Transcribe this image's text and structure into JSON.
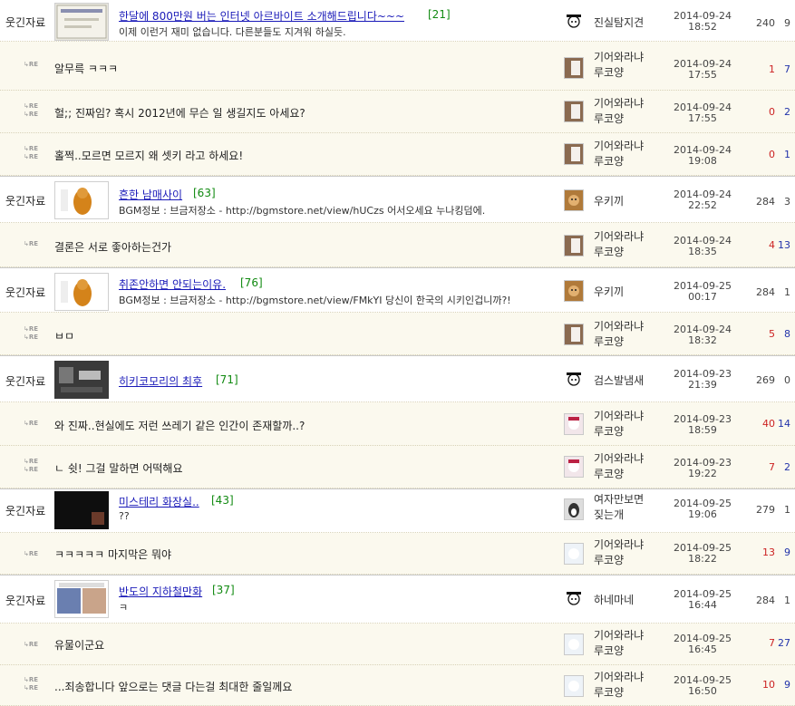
{
  "rows": [
    {
      "type": "post",
      "category": "웃긴자료",
      "title": "한달에 800만원 버는 인터넷 아르바이트 소개해드립니다~~~",
      "count": "[21]",
      "desc": "이제 이런거 재미 없습니다. 다른분들도 지겨워 하실듯.",
      "author": "진실탐지견",
      "date": "2014-09-24",
      "time": "18:52",
      "n1": "240",
      "n2": "9"
    },
    {
      "type": "reply",
      "text": "알무륵 ㅋㅋㅋ",
      "author1": "기어와라냐",
      "author2": "루코양",
      "date": "2014-09-24",
      "time": "17:55",
      "n1": "1",
      "n2": "7"
    },
    {
      "type": "reply",
      "text": "헐;; 진짜임? 혹시 2012년에 무슨 일 생길지도 아세요?",
      "author1": "기어와라냐",
      "author2": "루코양",
      "date": "2014-09-24",
      "time": "17:55",
      "n1": "0",
      "n2": "2"
    },
    {
      "type": "reply",
      "text": "홀쩍..모르면 모르지 왜 셋키 라고 하세요!",
      "author1": "기어와라냐",
      "author2": "루코양",
      "date": "2014-09-24",
      "time": "19:08",
      "n1": "0",
      "n2": "1"
    },
    {
      "type": "post",
      "category": "웃긴자료",
      "title": "흔한 남매사이",
      "count": "[63]",
      "desc": "BGM정보 : 브금저장소 - http://bgmstore.net/view/hUCzs 어서오세요 누나킹덤에.",
      "author": "우키끼",
      "date": "2014-09-24",
      "time": "22:52",
      "n1": "284",
      "n2": "3"
    },
    {
      "type": "reply",
      "text": "결론은 서로 좋아하는건가",
      "author1": "기어와라냐",
      "author2": "루코양",
      "date": "2014-09-24",
      "time": "18:35",
      "n1": "4",
      "n2": "13"
    },
    {
      "type": "post",
      "category": "웃긴자료",
      "title": "취존안하면 안되는이유.",
      "count": "[76]",
      "desc": "BGM정보 : 브금저장소 - http://bgmstore.net/view/FMkYI 당신이 한국의 시키인겁니까?!",
      "author": "우키끼",
      "date": "2014-09-25",
      "time": "00:17",
      "n1": "284",
      "n2": "1"
    },
    {
      "type": "reply",
      "text": "ㅂㅁ",
      "author1": "기어와라냐",
      "author2": "루코양",
      "date": "2014-09-24",
      "time": "18:32",
      "n1": "5",
      "n2": "8"
    },
    {
      "type": "post",
      "category": "웃긴자료",
      "title": "히키코모리의 최후",
      "count": "[71]",
      "desc": "",
      "author": "검스발냄새",
      "date": "2014-09-23",
      "time": "21:39",
      "n1": "269",
      "n2": "0"
    },
    {
      "type": "reply",
      "text": "와 진짜..현실에도 저런 쓰레기 같은 인간이 존재할까..?",
      "author1": "기어와라냐",
      "author2": "루코양",
      "date": "2014-09-23",
      "time": "18:59",
      "n1": "40",
      "n2": "14"
    },
    {
      "type": "reply",
      "text": "ㄴ 쉿! 그걸 말하면 어떡해요",
      "author1": "기어와라냐",
      "author2": "루코양",
      "date": "2014-09-23",
      "time": "19:22",
      "n1": "7",
      "n2": "2"
    },
    {
      "type": "post",
      "category": "웃긴자료",
      "title": "미스테리 화장실..",
      "count": "[43]",
      "desc": "??",
      "author1": "여자만보면",
      "author2": "짖는개",
      "date": "2014-09-25",
      "time": "19:06",
      "n1": "279",
      "n2": "1"
    },
    {
      "type": "reply",
      "text": "ㅋㅋㅋㅋㅋ 마지막은 뭐야",
      "author1": "기어와라냐",
      "author2": "루코양",
      "date": "2014-09-25",
      "time": "18:22",
      "n1": "13",
      "n2": "9"
    },
    {
      "type": "post",
      "category": "웃긴자료",
      "title": "반도의 지하철만화",
      "count": "[37]",
      "desc": "ㅋ",
      "author": "하네마네",
      "date": "2014-09-25",
      "time": "16:44",
      "n1": "284",
      "n2": "1"
    },
    {
      "type": "reply",
      "text": "유물이군요",
      "author1": "기어와라냐",
      "author2": "루코양",
      "date": "2014-09-25",
      "time": "16:45",
      "n1": "7",
      "n2": "27"
    },
    {
      "type": "reply",
      "text": "...죄송합니다 앞으로는 댓글 다는걸 최대한 줄일께요",
      "author1": "기어와라냐",
      "author2": "루코양",
      "date": "2014-09-25",
      "time": "16:50",
      "n1": "10",
      "n2": "9"
    }
  ],
  "re_label": "RE",
  "colors": {
    "reply_bg": "#fbf9ee",
    "title_link": "#1a1ab8",
    "count": "#118a11",
    "reply_like": "#cc2222",
    "reply_count": "#2233aa"
  }
}
